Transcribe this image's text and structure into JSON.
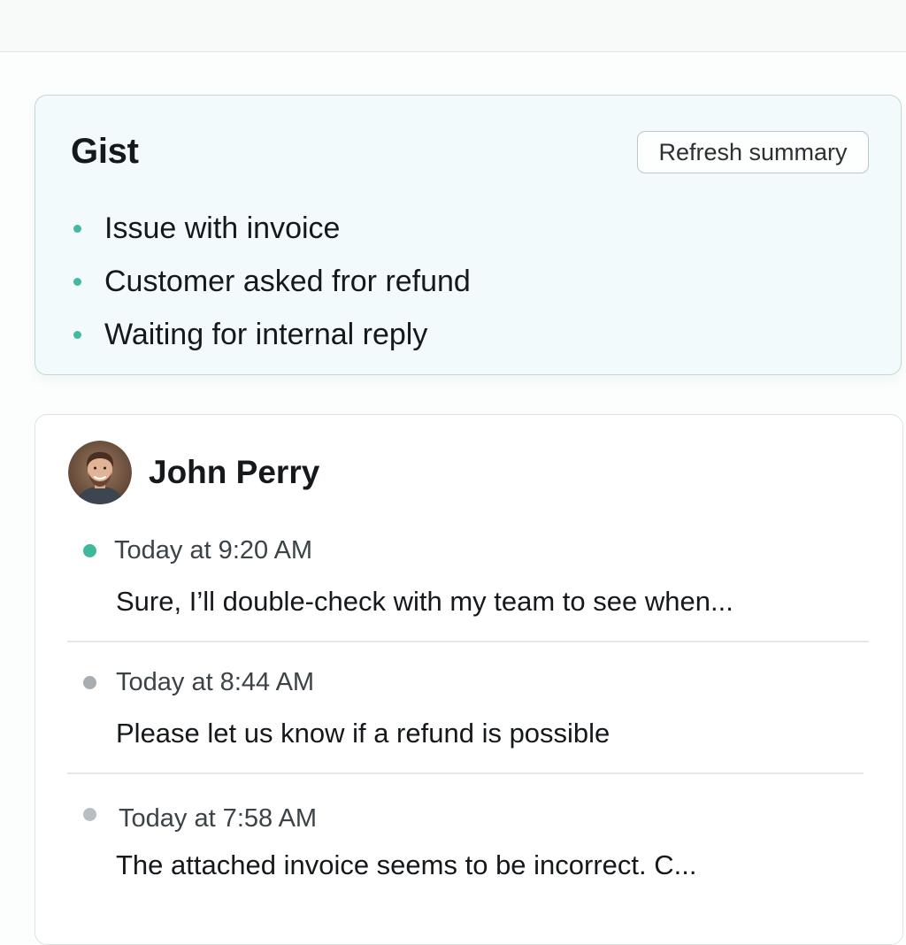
{
  "gist": {
    "title": "Gist",
    "refresh_label": "Refresh summary",
    "bullets": [
      "Issue with invoice",
      "Customer asked fror refund",
      "Waiting for internal reply"
    ],
    "bullet_color": "#43b9a0"
  },
  "thread": {
    "sender_name": "John Perry",
    "avatar_icon": "user-avatar-photo",
    "messages": [
      {
        "time": "Today at 9:20 AM",
        "preview": "Sure, I’ll double-check with my team to see when...",
        "status": "unread"
      },
      {
        "time": "Today at 8:44 AM",
        "preview": "Please let us know if a refund is possible",
        "status": "read"
      },
      {
        "time": "Today at 7:58 AM",
        "preview": "The attached invoice seems to be incorrect. C...",
        "status": "read"
      }
    ]
  },
  "colors": {
    "accent_teal": "#3fb89b",
    "read_dot_gray": "#a7adb1",
    "gist_card_bg": "#f3fafb",
    "gist_card_border": "#bfd7da"
  }
}
